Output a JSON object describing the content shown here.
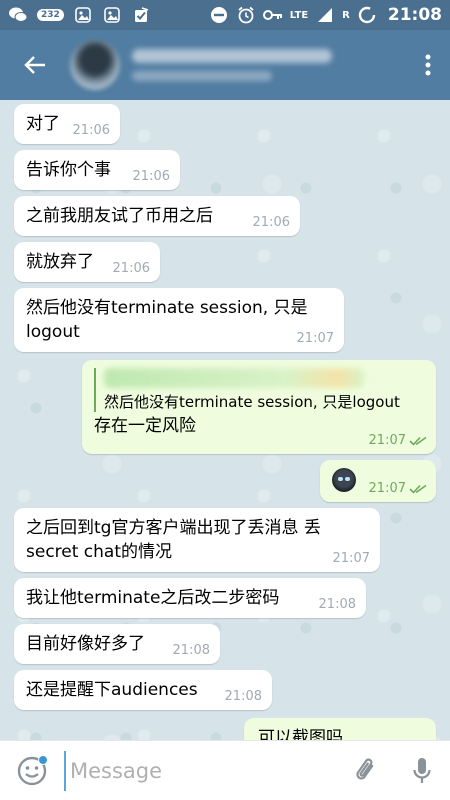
{
  "status_bar": {
    "icons_left": [
      "wechat-icon",
      "notification-badge",
      "gallery-icon",
      "gallery-icon",
      "clipboard-check-icon"
    ],
    "badge_count": "232",
    "network": "LTE",
    "roaming": "R",
    "time": "21:08"
  },
  "header": {
    "back_icon": "arrow-left-icon",
    "menu_icon": "more-vert-icon"
  },
  "messages": [
    {
      "dir": "in",
      "text": "对了",
      "time": "21:06"
    },
    {
      "dir": "in",
      "text": "告诉你个事",
      "time": "21:06"
    },
    {
      "dir": "in",
      "text": "之前我朋友试了币用之后",
      "time": "21:06"
    },
    {
      "dir": "in",
      "text": "就放弃了",
      "time": "21:06"
    },
    {
      "dir": "in",
      "text": "然后他没有terminate session, 只是logout",
      "time": "21:07"
    },
    {
      "dir": "out",
      "quote": "然后他没有terminate session, 只是logout",
      "text": "存在一定风险",
      "time": "21:07"
    },
    {
      "dir": "out",
      "sticker": "emoji-sticker",
      "time": "21:07"
    },
    {
      "dir": "in",
      "text": "之后回到tg官方客户端出现了丢消息 丢secret chat的情况",
      "time": "21:07"
    },
    {
      "dir": "in",
      "text": "我让他terminate之后改二步密码",
      "time": "21:08"
    },
    {
      "dir": "in",
      "text": "目前好像好多了",
      "time": "21:08"
    },
    {
      "dir": "in",
      "text": "还是提醒下audiences",
      "time": "21:08"
    },
    {
      "dir": "out",
      "text": "可以截图吗"
    }
  ],
  "input": {
    "placeholder": "Message",
    "emoji_icon": "emoji-icon",
    "attach_icon": "paperclip-icon",
    "mic_icon": "microphone-icon"
  },
  "colors": {
    "status_bar": "#4a6f8f",
    "header": "#517da2",
    "incoming_bubble": "#ffffff",
    "outgoing_bubble": "#effdde",
    "read_check": "#6cab5e"
  }
}
